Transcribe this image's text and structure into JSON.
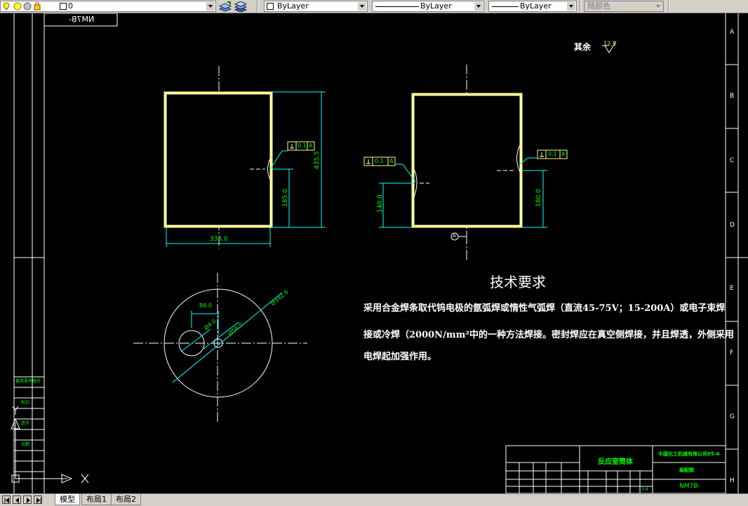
{
  "toolbar": {
    "layer_name": "0",
    "color_value": "ByLayer",
    "linetype_value": "ByLayer",
    "lineweight_value": "ByLayer",
    "plotstyle_value": "随颜色"
  },
  "drawing": {
    "roughness_label": "其余",
    "roughness_value": "12.5",
    "tech_title": "技术要求",
    "tech_lines": [
      "采用合金焊条取代钨电极的氩弧焊或惰性气弧焊（直流45-75V；15-200A）或电子束焊",
      "接或冷焊（2000N/mm²中的一种方法焊接。密封焊应在真空侧焊接，并且焊透，外侧采用",
      "电焊起加强作用。"
    ],
    "dims": {
      "left_height": "435.5",
      "left_mid": "185.0",
      "left_width": "335.0",
      "right_low": "140.0",
      "right_mid": "180.0",
      "tol": "0.1",
      "datum": "A",
      "circle_outer": "Ø342.0",
      "circle_hole": "Ø4.0",
      "circle_offset": "88.0",
      "circle_small": "Ø56.0"
    },
    "mirror_label": "NM7B-",
    "zone_letters": [
      "A",
      "B",
      "C",
      "D",
      "E",
      "F",
      "G",
      "H"
    ],
    "titleblock": {
      "part_name": "反应室筒体",
      "drawing_no": "NM7B-",
      "material_top": "中国化工机械有限公司05-4",
      "scale": "1:4",
      "material": "装配图"
    },
    "side_notes": [
      "备用零件图号",
      "标记",
      "签字",
      "日期"
    ]
  },
  "tabs": [
    {
      "label": "模型",
      "active": true
    },
    {
      "label": "布局1",
      "active": false
    },
    {
      "label": "布局2",
      "active": false
    }
  ],
  "colors": {
    "toolbar_bg": "#d4d0c8",
    "canvas_bg": "#000000",
    "object": "#ffffff",
    "dimension": "#00ffff",
    "annotation": "#00ff00",
    "tolerance_box": "#ffff80"
  },
  "icons": [
    "lightbulb-icon",
    "sun-icon",
    "lock-icon",
    "layer-manager-icon",
    "make-layer-current-icon",
    "ucs-icon"
  ]
}
